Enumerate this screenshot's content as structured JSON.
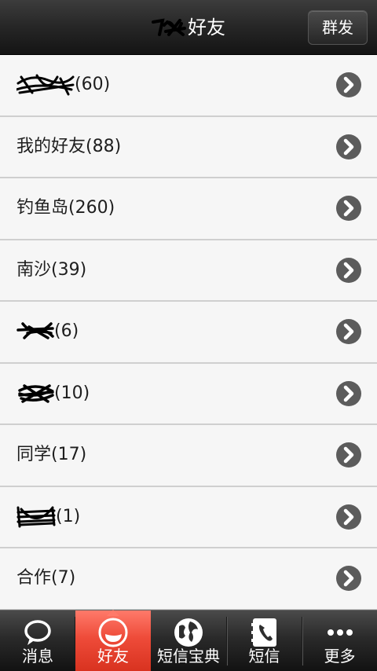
{
  "header": {
    "title": "好友",
    "group_send_label": "群发"
  },
  "groups": [
    {
      "label": "(60)",
      "redacted": true
    },
    {
      "label": "我的好友(88)",
      "redacted": false
    },
    {
      "label": "钓鱼岛(260)",
      "redacted": false
    },
    {
      "label": "南沙(39)",
      "redacted": false
    },
    {
      "label": "(6)",
      "redacted": true
    },
    {
      "label": "(10)",
      "redacted": true
    },
    {
      "label": "同学(17)",
      "redacted": false
    },
    {
      "label": "(1)",
      "redacted": true
    },
    {
      "label": "合作(7)",
      "redacted": false
    }
  ],
  "tabs": [
    {
      "label": "消息",
      "icon": "chat-bubble-icon",
      "active": false
    },
    {
      "label": "好友",
      "icon": "friends-icon",
      "active": true
    },
    {
      "label": "短信宝典",
      "icon": "globe-icon",
      "active": false
    },
    {
      "label": "短信",
      "icon": "sms-phone-icon",
      "active": false
    },
    {
      "label": "更多",
      "icon": "more-dots-icon",
      "active": false
    }
  ],
  "colors": {
    "header": "#262626",
    "active_tab": "#ee4b39",
    "chevron": "#5c5c5c",
    "row_bg": "#f6f6f6"
  }
}
